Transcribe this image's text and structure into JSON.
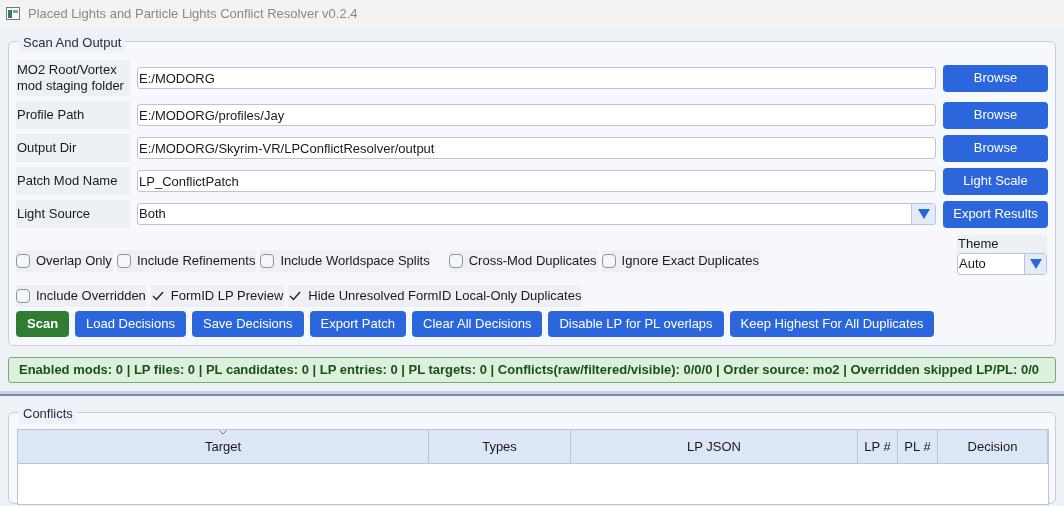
{
  "window": {
    "title": "Placed Lights and Particle Lights Conflict Resolver v0.2.4"
  },
  "scan_and_output": {
    "title": "Scan And Output",
    "fields": [
      {
        "kind": "text",
        "label": "MO2 Root/Vortex mod staging folder",
        "value": "E:/MODORG",
        "button": "Browse"
      },
      {
        "kind": "text",
        "label": "Profile Path",
        "value": "E:/MODORG/profiles/Jay",
        "button": "Browse"
      },
      {
        "kind": "text",
        "label": "Output Dir",
        "value": "E:/MODORG/Skyrim-VR/LPConflictResolver/output",
        "button": "Browse"
      },
      {
        "kind": "text",
        "label": "Patch Mod Name",
        "value": "LP_ConflictPatch",
        "button": "Light Scale"
      },
      {
        "kind": "dropdown",
        "label": "Light Source",
        "value": "Both",
        "button": "Export Results"
      }
    ],
    "options_row_1": [
      {
        "label": "Overlap Only",
        "checked": false
      },
      {
        "label": "Include Refinements",
        "checked": false
      },
      {
        "label": "Include Worldspace Splits",
        "checked": false
      },
      {
        "label": "Cross-Mod Duplicates",
        "checked": false
      },
      {
        "label": "Ignore Exact Duplicates",
        "checked": false
      }
    ],
    "theme": {
      "label": "Theme",
      "value": "Auto"
    },
    "options_row_2": [
      {
        "label": "Include Overridden",
        "checked": false
      },
      {
        "label": "FormID LP Preview",
        "checked": true
      },
      {
        "label": "Hide Unresolved FormID Local-Only Duplicates",
        "checked": true
      }
    ],
    "actions": [
      {
        "kind": "primary",
        "label": "Scan"
      },
      {
        "kind": "normal",
        "label": "Load Decisions"
      },
      {
        "kind": "normal",
        "label": "Save Decisions"
      },
      {
        "kind": "normal",
        "label": "Export Patch"
      },
      {
        "kind": "normal",
        "label": "Clear All Decisions"
      },
      {
        "kind": "normal",
        "label": "Disable LP for PL overlaps"
      },
      {
        "kind": "normal",
        "label": "Keep Highest For All Duplicates"
      }
    ]
  },
  "status_bar": "Enabled mods: 0 | LP files: 0 | PL candidates: 0 | LP entries: 0 | PL targets: 0 | Conflicts(raw/filtered/visible): 0/0/0 | Order source: mo2 | Overridden skipped LP/PL: 0/0",
  "conflicts": {
    "title": "Conflicts",
    "table": {
      "columns": [
        {
          "label": "Target",
          "sorted": true
        },
        {
          "label": "Types",
          "sorted": false
        },
        {
          "label": "LP JSON",
          "sorted": false
        },
        {
          "label": "LP #",
          "sorted": false
        },
        {
          "label": "PL #",
          "sorted": false
        },
        {
          "label": "Decision",
          "sorted": false
        }
      ]
    }
  }
}
